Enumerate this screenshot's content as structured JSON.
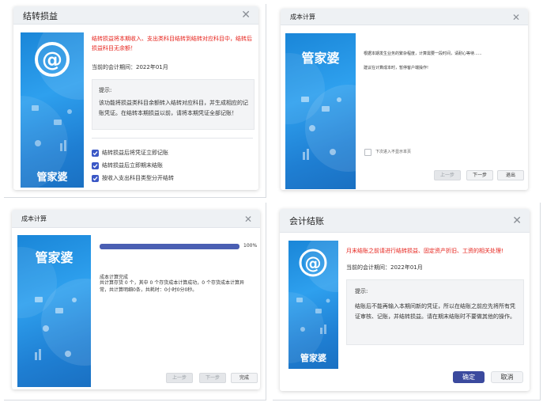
{
  "dialog1": {
    "title": "结转损益",
    "warning": "结转损益将本期收入、支出类科目结转到结转对应科目中，结转后损益科目无余额！",
    "period_label": "当前的会计期间：",
    "period_value": "2022年01月",
    "tip_title": "提示:",
    "tip_text": "该功能将损益类科目余额转入结转对应科目，并生成相应的记账凭证。在结转本期损益以前，请将本期凭证全部记账！",
    "options": [
      {
        "label": "结转损益后将凭证立即记账",
        "checked": true
      },
      {
        "label": "结转损益后立即期末结账",
        "checked": true
      },
      {
        "label": "按收入支出科目类型分开结转",
        "checked": true
      }
    ]
  },
  "dialog2": {
    "title": "成本计算",
    "desc": "根据本期发生业务的繁杂程度，计算需要一段时间，请耐心等待......",
    "advice": "建议在计算成本时，暂停客户端操作!",
    "skip_label": "下次进入不显示本页",
    "buttons": {
      "prev": "上一步",
      "next": "下一步",
      "exit": "退出"
    }
  },
  "dialog3": {
    "title": "成本计算",
    "progress_percent": 100,
    "progress_label": "100%",
    "result_title": "成本计算完成",
    "result_text": "共计算存货 0 个，其中 0 个存货成本计算成功，0 个存货成本计算异常，共计算明细0条，共耗时：0小时0分0秒。",
    "buttons": {
      "prev": "上一步",
      "next": "下一步",
      "finish": "完成"
    }
  },
  "dialog4": {
    "title": "会计结账",
    "warning": "月末结账之前请进行结转损益、固定资产折旧、工资的相关处理!",
    "period_label": "当前的会计期间：",
    "period_value": "2022年01月",
    "tip_title": "提示:",
    "tip_text": "结账后不能再输入本期间新的凭证，所以在结账之前应先将所有凭证审核、记账，并结转损益。请在期末结账时不要做其他的操作。",
    "buttons": {
      "confirm": "确定",
      "cancel": "取消"
    }
  },
  "brand_text": "管家婆",
  "colors": {
    "accent": "#3b58c6",
    "warning": "#e6211a",
    "banner": "#1f8ee0"
  }
}
